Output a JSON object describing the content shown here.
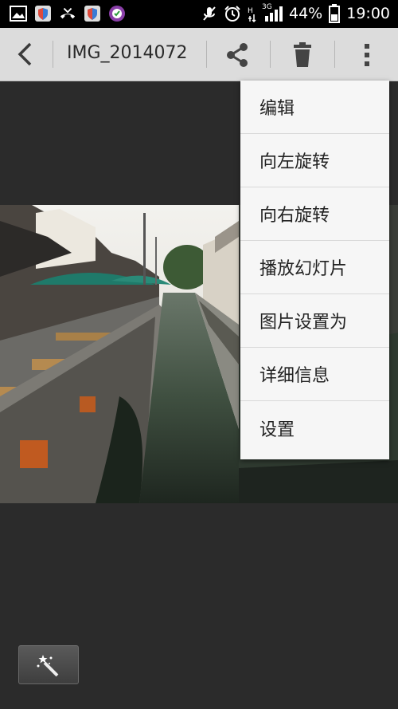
{
  "status_bar": {
    "battery": "44%",
    "time": "19:00",
    "network": "3G"
  },
  "action_bar": {
    "title": "IMG_2014072"
  },
  "menu": {
    "items": [
      {
        "label": "编辑"
      },
      {
        "label": "向左旋转"
      },
      {
        "label": "向右旋转"
      },
      {
        "label": "播放幻灯片"
      },
      {
        "label": "图片设置为"
      },
      {
        "label": "详细信息"
      },
      {
        "label": "设置"
      }
    ]
  },
  "icons": {
    "back": "back-arrow-icon",
    "share": "share-icon",
    "delete": "trash-icon",
    "overflow": "overflow-menu-icon",
    "magic": "magic-wand-icon"
  }
}
